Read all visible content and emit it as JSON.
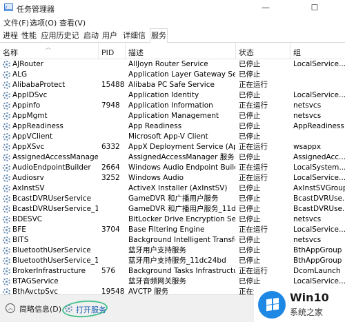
{
  "window": {
    "title": "任务管理器",
    "minimize_glyph": "—",
    "maximize_glyph": "☐"
  },
  "menu": [
    "文件(F)",
    "选项(O)",
    "查看(V)"
  ],
  "tabs": [
    "进程",
    "性能",
    "应用历史记录",
    "启动",
    "用户",
    "详细信息",
    "服务"
  ],
  "active_tab": "服务",
  "columns": {
    "name": "名称",
    "pid": "PID",
    "desc": "描述",
    "status": "状态",
    "group": "组"
  },
  "services": [
    {
      "name": "AJRouter",
      "pid": "",
      "desc": "AllJoyn Router Service",
      "status": "已停止",
      "group": "LocalService..."
    },
    {
      "name": "ALG",
      "pid": "",
      "desc": "Application Layer Gateway Serv...",
      "status": "已停止",
      "group": ""
    },
    {
      "name": "AlibabaProtect",
      "pid": "15488",
      "desc": "Alibaba PC Safe Service",
      "status": "正在运行",
      "group": ""
    },
    {
      "name": "AppIDSvc",
      "pid": "",
      "desc": "Application Identity",
      "status": "已停止",
      "group": "LocalService..."
    },
    {
      "name": "Appinfo",
      "pid": "7948",
      "desc": "Application Information",
      "status": "正在运行",
      "group": "netsvcs"
    },
    {
      "name": "AppMgmt",
      "pid": "",
      "desc": "Application Management",
      "status": "已停止",
      "group": "netsvcs"
    },
    {
      "name": "AppReadiness",
      "pid": "",
      "desc": "App Readiness",
      "status": "已停止",
      "group": "AppReadiness"
    },
    {
      "name": "AppVClient",
      "pid": "",
      "desc": "Microsoft App-V Client",
      "status": "已停止",
      "group": ""
    },
    {
      "name": "AppXSvc",
      "pid": "6332",
      "desc": "AppX Deployment Service (Ap...",
      "status": "正在运行",
      "group": "wsappx"
    },
    {
      "name": "AssignedAccessManager...",
      "pid": "",
      "desc": "AssignedAccessManager 服务",
      "status": "已停止",
      "group": "AssignedAcc..."
    },
    {
      "name": "AudioEndpointBuilder",
      "pid": "2664",
      "desc": "Windows Audio Endpoint Builder",
      "status": "正在运行",
      "group": "LocalSystem..."
    },
    {
      "name": "Audiosrv",
      "pid": "3252",
      "desc": "Windows Audio",
      "status": "正在运行",
      "group": "LocalService..."
    },
    {
      "name": "AxInstSV",
      "pid": "",
      "desc": "ActiveX Installer (AxInstSV)",
      "status": "已停止",
      "group": "AxInstSVGroup"
    },
    {
      "name": "BcastDVRUserService",
      "pid": "",
      "desc": "GameDVR 和广播用户服务",
      "status": "已停止",
      "group": "BcastDVRUse..."
    },
    {
      "name": "BcastDVRUserService_11...",
      "pid": "",
      "desc": "GameDVR 和广播用户服务_11dc...",
      "status": "已停止",
      "group": "BcastDVRUse..."
    },
    {
      "name": "BDESVC",
      "pid": "",
      "desc": "BitLocker Drive Encryption Serv...",
      "status": "已停止",
      "group": "netsvcs"
    },
    {
      "name": "BFE",
      "pid": "3704",
      "desc": "Base Filtering Engine",
      "status": "正在运行",
      "group": "LocalService..."
    },
    {
      "name": "BITS",
      "pid": "",
      "desc": "Background Intelligent Transfer...",
      "status": "已停止",
      "group": "netsvcs"
    },
    {
      "name": "BluetoothUserService",
      "pid": "",
      "desc": "蓝牙用户支持服务",
      "status": "已停止",
      "group": "BthAppGroup"
    },
    {
      "name": "BluetoothUserService_11...",
      "pid": "",
      "desc": "蓝牙用户支持服务_11dc24bd",
      "status": "已停止",
      "group": "BthAppGroup"
    },
    {
      "name": "BrokerInfrastructure",
      "pid": "576",
      "desc": "Background Tasks Infrastructur...",
      "status": "正在运行",
      "group": "DcomLaunch"
    },
    {
      "name": "BTAGService",
      "pid": "",
      "desc": "蓝牙音频网关服务",
      "status": "已停止",
      "group": "LocalService..."
    },
    {
      "name": "BthAvctpSvc",
      "pid": "19548",
      "desc": "AVCTP 服务",
      "status": "正在运行",
      "group": "LocalService..."
    }
  ],
  "footer": {
    "fewer_details": "简略信息(D)",
    "open_services": "打开服务"
  },
  "badge": {
    "title": "Win10",
    "site": "系统之家"
  }
}
